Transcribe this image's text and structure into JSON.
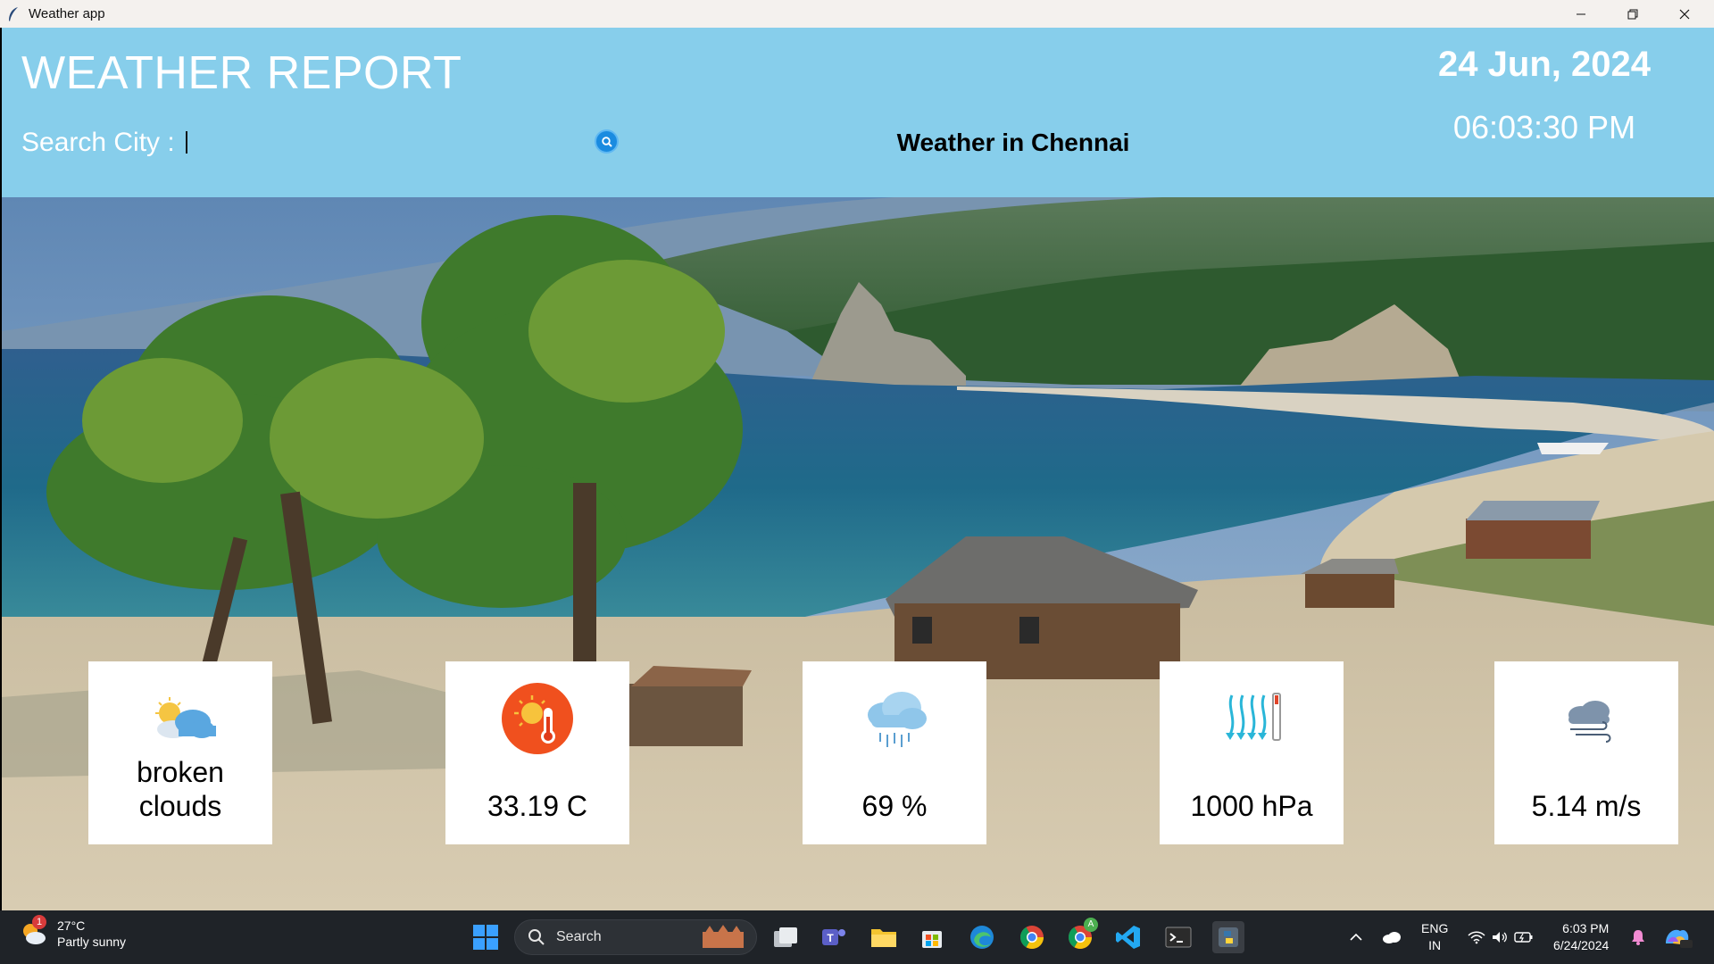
{
  "window": {
    "title": "Weather app"
  },
  "header": {
    "heading": "WEATHER REPORT",
    "search_label": "Search City :",
    "search_value": "",
    "weather_in": "Weather in Chennai",
    "date": "24 Jun, 2024",
    "time": "06:03:30 PM"
  },
  "cards": [
    {
      "icon": "broken-clouds-icon",
      "value_line1": "broken",
      "value_line2": "clouds"
    },
    {
      "icon": "thermometer-sun-icon",
      "value": "33.19 C"
    },
    {
      "icon": "rain-cloud-icon",
      "value": "69 %"
    },
    {
      "icon": "pressure-icon",
      "value": "1000 hPa"
    },
    {
      "icon": "wind-icon",
      "value": "5.14 m/s"
    }
  ],
  "taskbar": {
    "weather_temp": "27°C",
    "weather_desc": "Partly sunny",
    "weather_badge": "1",
    "search_label": "Search",
    "lang_top": "ENG",
    "lang_bottom": "IN",
    "clock_time": "6:03 PM",
    "clock_date": "6/24/2024",
    "chrome_badge": "A"
  },
  "colors": {
    "header_bg": "#87ceeb",
    "taskbar_bg": "#1f2328"
  }
}
